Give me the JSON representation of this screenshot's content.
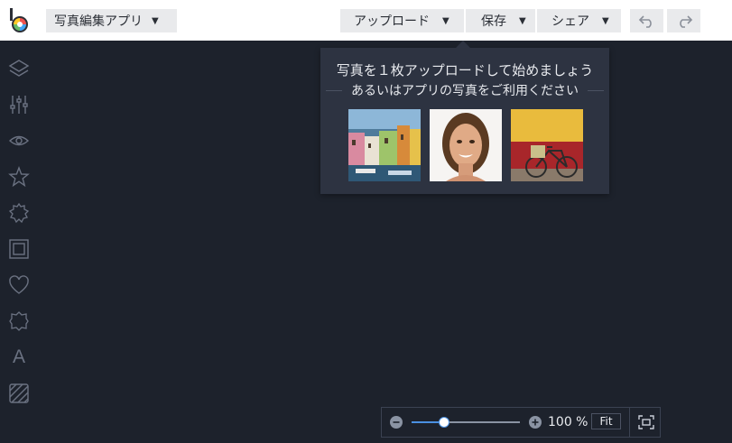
{
  "app_menu": {
    "label": "写真編集アプリ",
    "caret": "▼"
  },
  "toolbar": {
    "upload_label": "アップロード",
    "save_label": "保存",
    "share_label": "シェア",
    "caret": "▼"
  },
  "sidebar": {
    "tools": [
      {
        "name": "layers-icon"
      },
      {
        "name": "adjust-sliders-icon"
      },
      {
        "name": "eye-icon"
      },
      {
        "name": "star-icon"
      },
      {
        "name": "badge-icon"
      },
      {
        "name": "frame-icon"
      },
      {
        "name": "heart-icon"
      },
      {
        "name": "shape-icon"
      },
      {
        "name": "text-icon",
        "glyph": "A"
      },
      {
        "name": "texture-icon"
      }
    ]
  },
  "popup": {
    "title": "写真を１枚アップロードして始めましょう",
    "subtitle": "あるいはアプリの写真をご利用ください",
    "samples": [
      "colorful-houses-photo",
      "woman-portrait-photo",
      "bicycle-yellow-wall-photo"
    ]
  },
  "zoom": {
    "value_text": "100 %",
    "fit_label": "Fit",
    "level": 0.3
  },
  "colors": {
    "canvas_bg": "#1d222c",
    "topbar_bg": "#ffffff",
    "accent": "#4a90e2"
  }
}
